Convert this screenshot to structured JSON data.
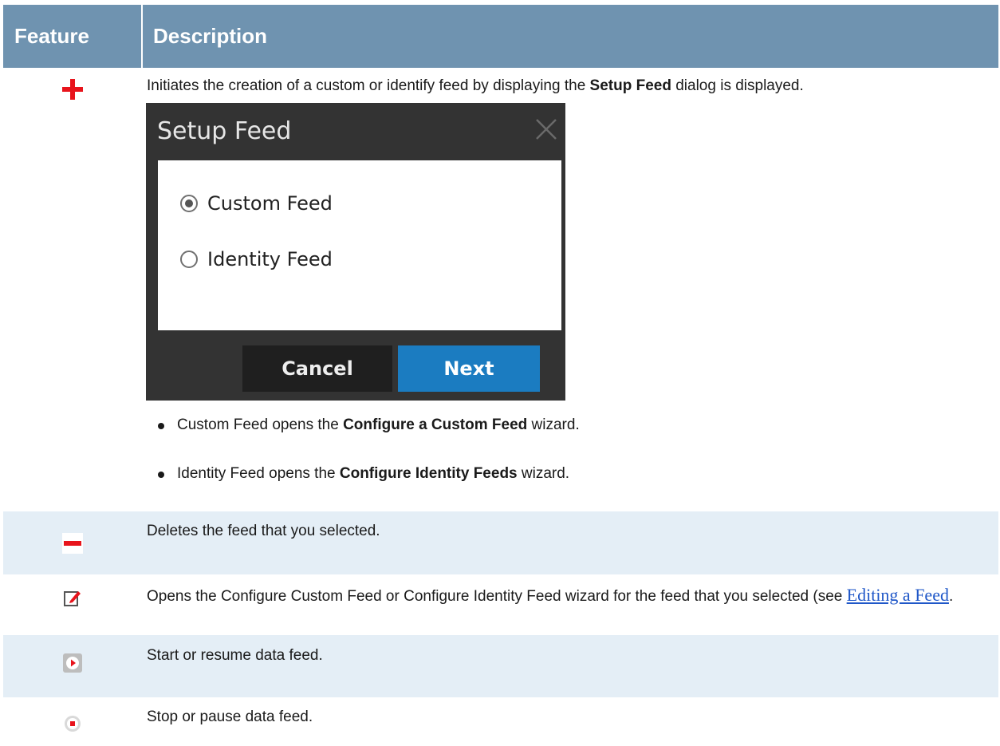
{
  "table": {
    "headers": {
      "feature": "Feature",
      "description": "Description"
    },
    "rows": [
      {
        "icon": "add-plus-icon",
        "desc_pre": "Initiates the creation of a custom or identify feed by displaying the ",
        "desc_bold": "Setup Feed",
        "desc_post": " dialog is displayed.",
        "dialog": {
          "title": "Setup Feed",
          "options": [
            {
              "label": "Custom Feed",
              "checked": true
            },
            {
              "label": "Identity Feed",
              "checked": false
            }
          ],
          "cancel_label": "Cancel",
          "next_label": "Next"
        },
        "bullets": [
          {
            "pre": "Custom Feed opens the ",
            "bold": "Configure a Custom Feed",
            "post": " wizard."
          },
          {
            "pre": "Identity Feed opens the ",
            "bold": "Configure Identity Feeds",
            "post": " wizard."
          }
        ]
      },
      {
        "icon": "delete-minus-icon",
        "desc": "Deletes the feed that you selected."
      },
      {
        "icon": "edit-pencil-icon",
        "desc_pre": "Opens the Configure Custom Feed or Configure Identity Feed wizard for the feed that you selected (see ",
        "link": "Editing a Feed",
        "desc_post": "."
      },
      {
        "icon": "play-icon",
        "desc": "Start or resume data feed."
      },
      {
        "icon": "stop-icon",
        "desc": "Stop or pause data feed."
      }
    ]
  },
  "colors": {
    "header_bg": "#6f93b0",
    "alt_row_bg": "#e4eef6",
    "icon_red": "#e8141c",
    "link": "#1f57c8",
    "next_button": "#1b7cc1"
  }
}
